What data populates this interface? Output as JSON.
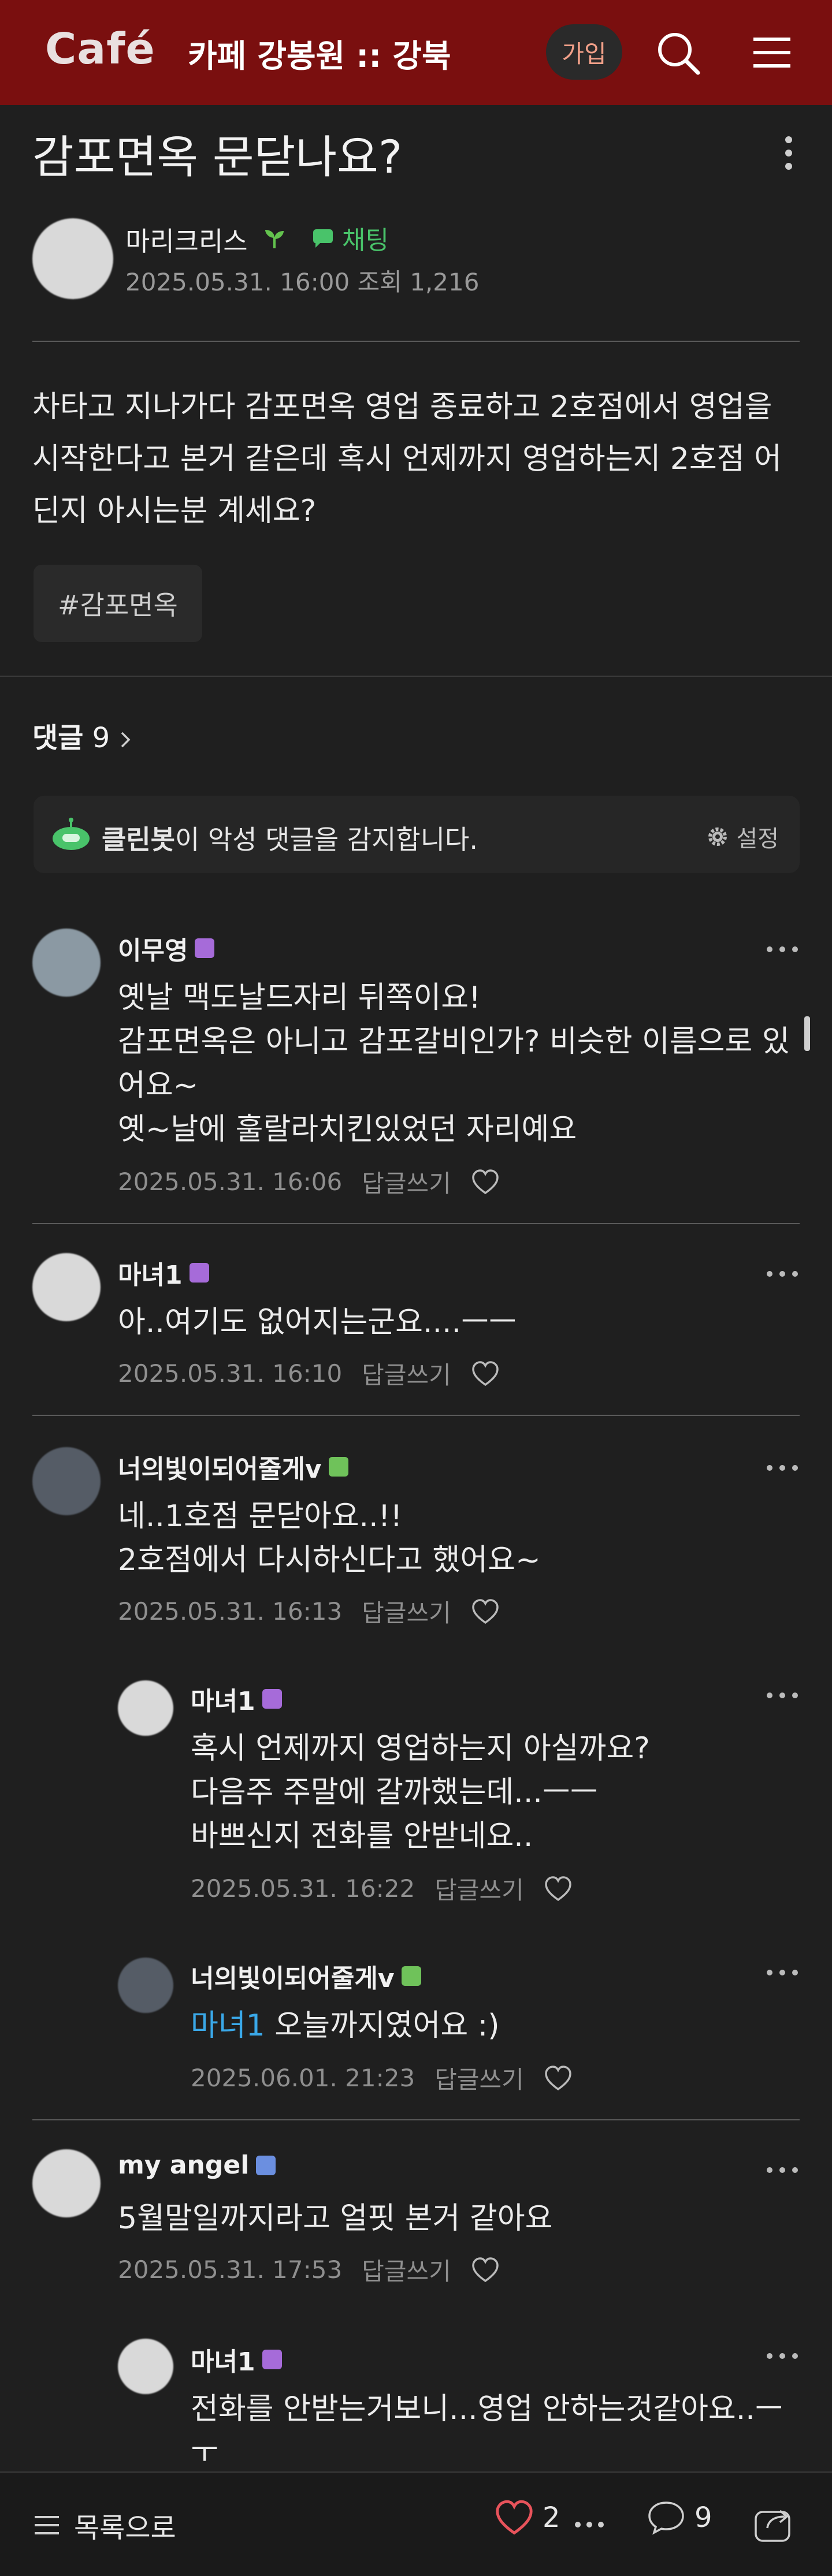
{
  "header": {
    "logo": "Café",
    "cafe_name": "카페 강봉원 :: 강북",
    "join_label": "가입"
  },
  "post": {
    "title": "감포면옥 문닫나요?",
    "author": "마리크리스",
    "chat_label": "채팅",
    "date": "2025.05.31. 16:00",
    "views_label": "조회 1,216",
    "body": "차타고 지나가다 감포면옥 영업 종료하고 2호점에서 영업을 시작한다고 본거 같은데 혹시 언제까지 영업하는지 2호점 어딘지 아시는분 계세요?",
    "tag": "#감포면옥"
  },
  "comments_section": {
    "label": "댓글",
    "count": "9",
    "cleanbot_name": "클린봇",
    "cleanbot_text": "이 악성 댓글을 감지합니다.",
    "settings_label": "설정"
  },
  "comments": [
    {
      "name": "이무영",
      "badge_color": "#a66bd9",
      "text": "옛날 맥도날드자리 뒤쪽이요!\n감포면옥은 아니고 감포갈비인가? 비슷한 이름으로 있어요~\n옛~날에 훌랄라치킨있었던 자리예요",
      "date": "2025.05.31. 16:06",
      "reply_label": "답글쓰기"
    },
    {
      "name": "마녀1",
      "badge_color": "#a66bd9",
      "text": "아..여기도 없어지는군요....ㅡㅡ",
      "date": "2025.05.31. 16:10",
      "reply_label": "답글쓰기"
    },
    {
      "name": "너의빛이되어줄게v",
      "badge_color": "#6fc25a",
      "text": "네..1호점 문닫아요..!!\n2호점에서 다시하신다고 했어요~",
      "date": "2025.05.31. 16:13",
      "reply_label": "답글쓰기"
    },
    {
      "name": "마녀1",
      "badge_color": "#a66bd9",
      "text": "혹시 언제까지 영업하는지 아실까요?\n다음주 주말에 갈까했는데...ㅡㅡ\n바쁘신지 전화를 안받네요..",
      "date": "2025.05.31. 16:22",
      "reply_label": "답글쓰기"
    },
    {
      "name": "너의빛이되어줄게v",
      "badge_color": "#6fc25a",
      "mention": "마녀1",
      "text": " 오늘까지였어요 :)",
      "date": "2025.06.01. 21:23",
      "reply_label": "답글쓰기"
    },
    {
      "name": "my angel",
      "badge_color": "#6b8fe0",
      "text": "5월말일까지라고 얼핏 본거 같아요",
      "date": "2025.05.31. 17:53",
      "reply_label": "답글쓰기"
    },
    {
      "name": "마녀1",
      "badge_color": "#a66bd9",
      "text": "전화를 안받는거보니...영업 안하는것같아요..ㅡ\nㅜ"
    }
  ],
  "bottom_bar": {
    "list_label": "목록으로",
    "like_count": "2",
    "comment_count": "9"
  }
}
